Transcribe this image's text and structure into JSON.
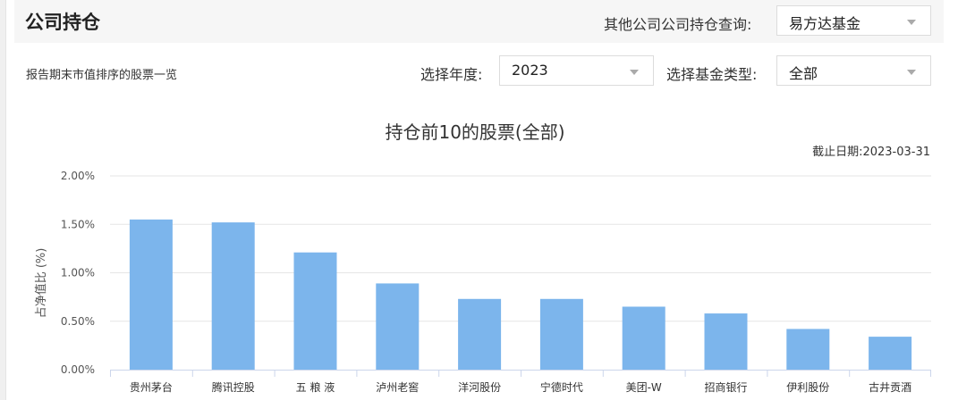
{
  "header": {
    "title": "公司持仓",
    "other_query_label": "其他公司公司持仓查询:",
    "company_select_value": "易方达基金"
  },
  "filters": {
    "subtitle": "报告期末市值排序的股票一览",
    "year_label": "选择年度:",
    "year_value": "2023",
    "fund_type_label": "选择基金类型:",
    "fund_type_value": "全部"
  },
  "chart_data": {
    "type": "bar",
    "title": "持仓前10的股票(全部)",
    "date_note": "截止日期:2023-03-31",
    "ylabel": "占净值比 (%)",
    "ylim": [
      0,
      2.0
    ],
    "yticks": [
      "0.00%",
      "0.50%",
      "1.00%",
      "1.50%",
      "2.00%"
    ],
    "categories": [
      "贵州茅台",
      "腾讯控股",
      "五 粮 液",
      "泸州老窖",
      "洋河股份",
      "宁德时代",
      "美团-W",
      "招商银行",
      "伊利股份",
      "古井贡酒"
    ],
    "values": [
      1.55,
      1.52,
      1.21,
      0.89,
      0.73,
      0.73,
      0.65,
      0.58,
      0.42,
      0.34
    ],
    "bar_color": "#7cb5ec",
    "grid": true
  }
}
